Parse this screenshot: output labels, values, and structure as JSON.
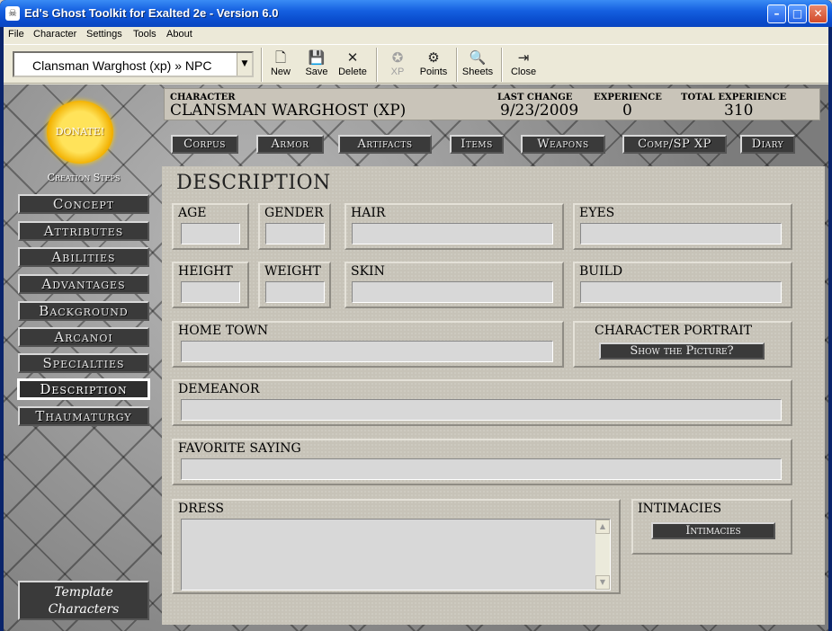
{
  "window": {
    "title": "Ed's Ghost Toolkit for Exalted 2e - Version 6.0"
  },
  "menu": [
    "File",
    "Character",
    "Settings",
    "Tools",
    "About"
  ],
  "toolbar": {
    "character_select": "Clansman Warghost (xp) » NPC",
    "buttons": {
      "new": "New",
      "save": "Save",
      "delete": "Delete",
      "xp": "XP",
      "points": "Points",
      "sheets": "Sheets",
      "close": "Close"
    }
  },
  "sidebar": {
    "donate": "DONATE!",
    "creation_title": "Creation Steps",
    "steps": [
      "Concept",
      "Attributes",
      "Abilities",
      "Advantages",
      "Background",
      "Arcanoi",
      "Specialties",
      "Description",
      "Thaumaturgy"
    ],
    "active_step": "Description",
    "template_line1": "Template",
    "template_line2": "Characters"
  },
  "header": {
    "character_label": "CHARACTER",
    "character_value": "CLANSMAN WARGHOST (XP)",
    "last_change_label": "LAST CHANGE",
    "last_change_value": "9/23/2009",
    "experience_label": "EXPERIENCE",
    "experience_value": "0",
    "total_experience_label": "TOTAL EXPERIENCE",
    "total_experience_value": "310"
  },
  "categories": [
    "Corpus",
    "Armor",
    "Artifacts",
    "Items",
    "Weapons",
    "Comp/SP XP",
    "Diary"
  ],
  "description": {
    "title": "DESCRIPTION",
    "age_label": "AGE",
    "gender_label": "GENDER",
    "hair_label": "HAIR",
    "eyes_label": "EYES",
    "height_label": "HEIGHT",
    "weight_label": "WEIGHT",
    "skin_label": "SKIN",
    "build_label": "BUILD",
    "hometown_label": "HOME TOWN",
    "portrait_label": "CHARACTER PORTRAIT",
    "portrait_button": "Show the Picture?",
    "demeanor_label": "DEMEANOR",
    "saying_label": "FAVORITE SAYING",
    "dress_label": "DRESS",
    "intimacies_label": "INTIMACIES",
    "intimacies_button": "Intimacies"
  }
}
